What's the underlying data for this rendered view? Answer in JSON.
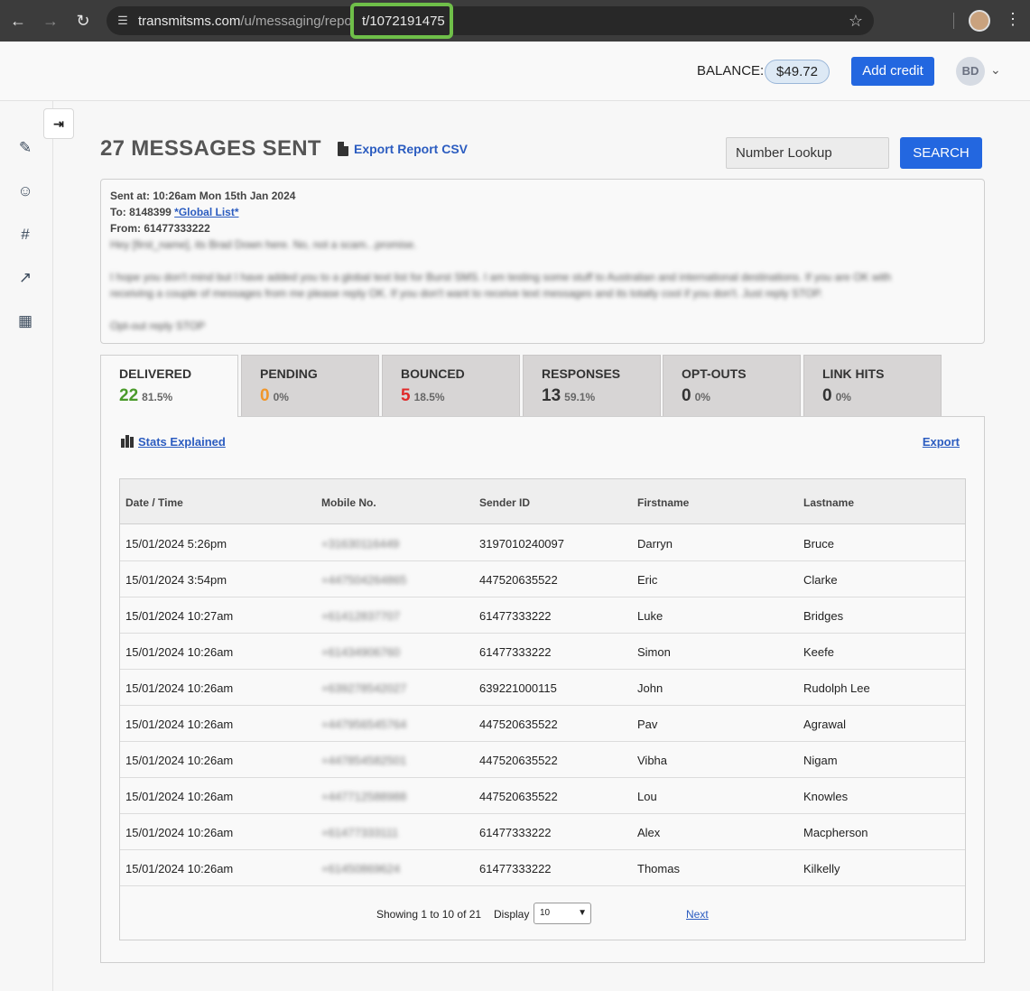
{
  "browser": {
    "url_host": "transmitsms.com",
    "url_path": "/u/messaging/repo",
    "url_highlighted": "t/1072191475"
  },
  "header": {
    "balance_label": "BALANCE:",
    "balance_value": "$49.72",
    "add_credit_label": "Add credit",
    "avatar_initials": "BD"
  },
  "page": {
    "title": "27 MESSAGES SENT",
    "export_csv_label": "Export Report CSV",
    "lookup_placeholder": "Number Lookup",
    "search_label": "SEARCH"
  },
  "message": {
    "sent_at": "Sent at: 10:26am Mon 15th Jan 2024",
    "to_prefix": "To: 8148399 ",
    "to_list": "*Global List*",
    "from": "From: 61477333222",
    "body_line1": "Hey [first_name], its Brad Down here. No, not a scam...promise.",
    "body_line2": "I hope you don't mind but I have added you to a global text list for Burst SMS. I am testing some stuff to Australian and international destinations. If you are OK with",
    "body_line3": "receiving a couple of messages from me please reply OK. If you don't want to receive text messages and its totally cool if you don't. Just reply STOP.",
    "body_line4": "Opt-out reply STOP"
  },
  "tabs": [
    {
      "label": "DELIVERED",
      "count": "22",
      "pct": "81.5%",
      "color": "#4a9a2a"
    },
    {
      "label": "PENDING",
      "count": "0",
      "pct": "0%",
      "color": "#f0962a"
    },
    {
      "label": "BOUNCED",
      "count": "5",
      "pct": "18.5%",
      "color": "#e02a2a"
    },
    {
      "label": "RESPONSES",
      "count": "13",
      "pct": "59.1%",
      "color": "#333333"
    },
    {
      "label": "OPT-OUTS",
      "count": "0",
      "pct": "0%",
      "color": "#333333"
    },
    {
      "label": "LINK HITS",
      "count": "0",
      "pct": "0%",
      "color": "#333333"
    }
  ],
  "panel": {
    "stats_link": "Stats Explained",
    "export_link": "Export"
  },
  "table": {
    "headers": [
      "Date / Time",
      "Mobile No.",
      "Sender ID",
      "Firstname",
      "Lastname"
    ],
    "rows": [
      [
        "15/01/2024 5:26pm",
        "+31630116449",
        "3197010240097",
        "Darryn",
        "Bruce"
      ],
      [
        "15/01/2024 3:54pm",
        "+447504264865",
        "447520635522",
        "Eric",
        "Clarke"
      ],
      [
        "15/01/2024 10:27am",
        "+61412837707",
        "61477333222",
        "Luke",
        "Bridges"
      ],
      [
        "15/01/2024 10:26am",
        "+61434906760",
        "61477333222",
        "Simon",
        "Keefe"
      ],
      [
        "15/01/2024 10:26am",
        "+639278542027",
        "639221000115",
        "John",
        "Rudolph Lee"
      ],
      [
        "15/01/2024 10:26am",
        "+447956545764",
        "447520635522",
        "Pav",
        "Agrawal"
      ],
      [
        "15/01/2024 10:26am",
        "+447854582501",
        "447520635522",
        "Vibha",
        "Nigam"
      ],
      [
        "15/01/2024 10:26am",
        "+447712588988",
        "447520635522",
        "Lou",
        "Knowles"
      ],
      [
        "15/01/2024 10:26am",
        "+61477333111",
        "61477333222",
        "Alex",
        "Macpherson"
      ],
      [
        "15/01/2024 10:26am",
        "+61450869624",
        "61477333222",
        "Thomas",
        "Kilkelly"
      ]
    ],
    "pager_text": "Showing 1 to 10 of 21",
    "display_label": "Display",
    "display_value": "10",
    "next_label": "Next"
  }
}
